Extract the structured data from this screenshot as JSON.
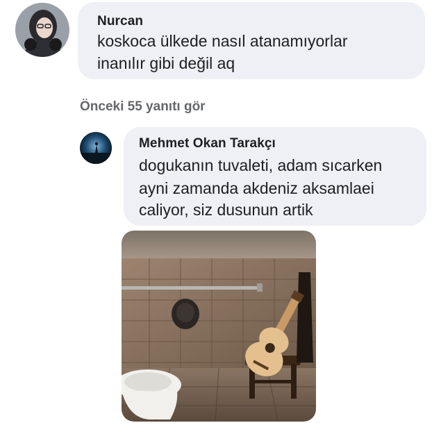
{
  "comments": [
    {
      "author": "Nurcan",
      "lines": [
        "koskoca ülkede nasıl atanamıyorlar",
        "inanılır gibi değil aq"
      ]
    }
  ],
  "view_previous": "Önceki 55 yanıtı gör",
  "replies": [
    {
      "author": "Mehmet Okan Tarakçı",
      "lines": [
        "dogukanın tuvaleti, adam sıcarken",
        "ayni zamanda akdeniz aksamlaei",
        "caliyor, siz dusunun artik"
      ],
      "attachment_icon": "photo"
    }
  ],
  "colors": {
    "bubble": "#eef0f5",
    "text": "#1c1e21",
    "secondary": "#65676b"
  }
}
